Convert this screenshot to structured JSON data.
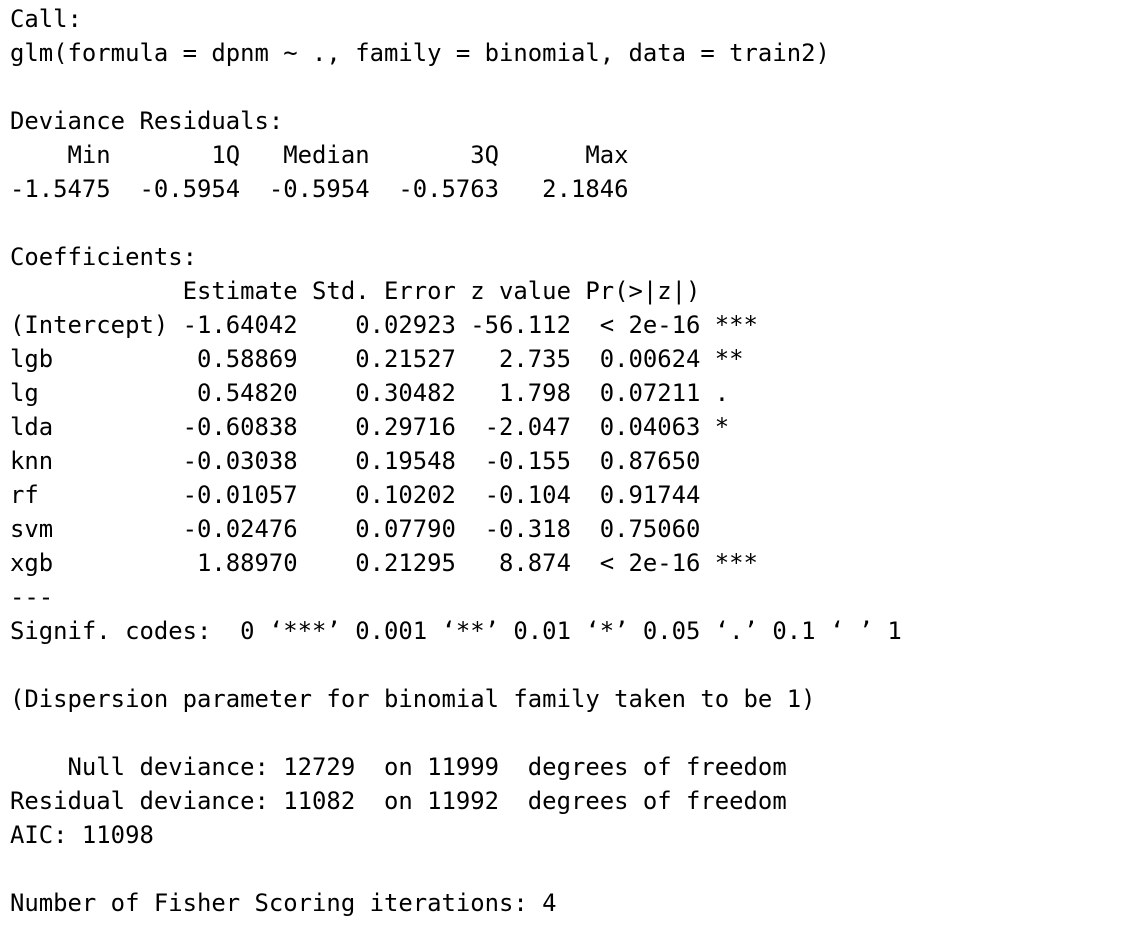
{
  "output": {
    "lines": [
      "Call:",
      "glm(formula = dpnm ~ ., family = binomial, data = train2)",
      "",
      "Deviance Residuals:",
      "    Min       1Q   Median       3Q      Max",
      "-1.5475  -0.5954  -0.5954  -0.5763   2.1846",
      "",
      "Coefficients:",
      "            Estimate Std. Error z value Pr(>|z|)",
      "(Intercept) -1.64042    0.02923 -56.112  < 2e-16 ***",
      "lgb          0.58869    0.21527   2.735  0.00624 **",
      "lg           0.54820    0.30482   1.798  0.07211 .",
      "lda         -0.60838    0.29716  -2.047  0.04063 *",
      "knn         -0.03038    0.19548  -0.155  0.87650",
      "rf          -0.01057    0.10202  -0.104  0.91744",
      "svm         -0.02476    0.07790  -0.318  0.75060",
      "xgb          1.88970    0.21295   8.874  < 2e-16 ***",
      "---",
      "Signif. codes:  0 ‘***’ 0.001 ‘**’ 0.01 ‘*’ 0.05 ‘.’ 0.1 ‘ ’ 1",
      "",
      "(Dispersion parameter for binomial family taken to be 1)",
      "",
      "    Null deviance: 12729  on 11999  degrees of freedom",
      "Residual deviance: 11082  on 11992  degrees of freedom",
      "AIC: 11098",
      "",
      "Number of Fisher Scoring iterations: 4"
    ]
  }
}
